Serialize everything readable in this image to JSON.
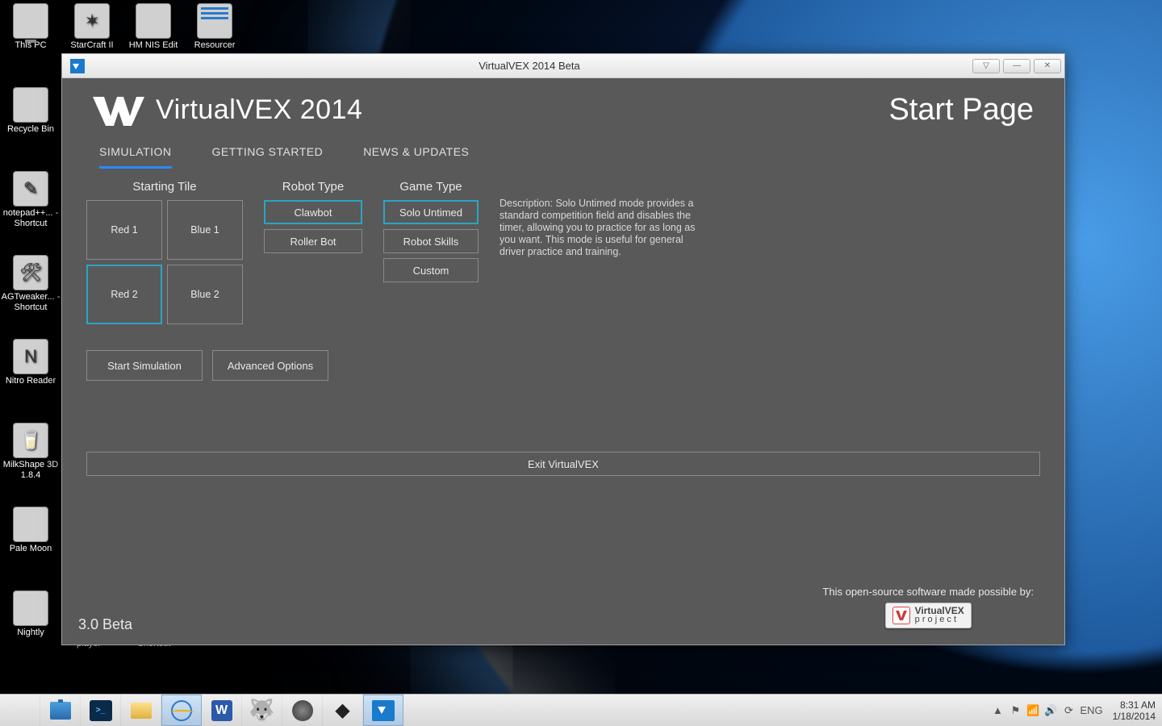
{
  "desktop_icons": {
    "this_pc": "This PC",
    "starcraft": "StarCraft II",
    "nsis": "HM NIS Edit",
    "resourcer": "Resourcer",
    "recycle": "Recycle Bin",
    "notepadpp": "notepad++... - Shortcut",
    "agtweaker": "AGTweaker... - Shortcut",
    "nitro": "Nitro Reader",
    "milkshape": "MilkShape 3D 1.8.4",
    "palemoon": "Pale Moon",
    "nightly": "Nightly",
    "player": "player",
    "shortcut": "Shortcut"
  },
  "window": {
    "title": "VirtualVEX 2014 Beta"
  },
  "win_controls": {
    "dropdown": "▽",
    "minimize": "—",
    "close": "✕"
  },
  "app": {
    "title": "VirtualVEX 2014",
    "page": "Start Page",
    "version": "3.0 Beta"
  },
  "tabs": {
    "simulation": "SIMULATION",
    "getting_started": "GETTING STARTED",
    "news": "NEWS & UPDATES"
  },
  "groups": {
    "tile": "Starting Tile",
    "robot": "Robot Type",
    "game": "Game Type"
  },
  "tiles": {
    "red1": "Red 1",
    "blue1": "Blue 1",
    "red2": "Red 2",
    "blue2": "Blue 2"
  },
  "robot": {
    "clawbot": "Clawbot",
    "roller": "Roller Bot"
  },
  "game": {
    "solo": "Solo Untimed",
    "skills": "Robot Skills",
    "custom": "Custom"
  },
  "description": "Description: Solo Untimed mode provides a standard competition field and disables the timer, allowing you to practice for as long as you want. This mode is useful for general driver practice and training.",
  "actions": {
    "start": "Start Simulation",
    "advanced": "Advanced Options",
    "exit": "Exit VirtualVEX"
  },
  "credit": {
    "line": "This open-source software made possible by:",
    "badge_top": "VirtualVEX",
    "badge_bot": "p r o j e c t"
  },
  "tray": {
    "lang": "ENG",
    "time": "8:31 AM",
    "date": "1/18/2014"
  }
}
